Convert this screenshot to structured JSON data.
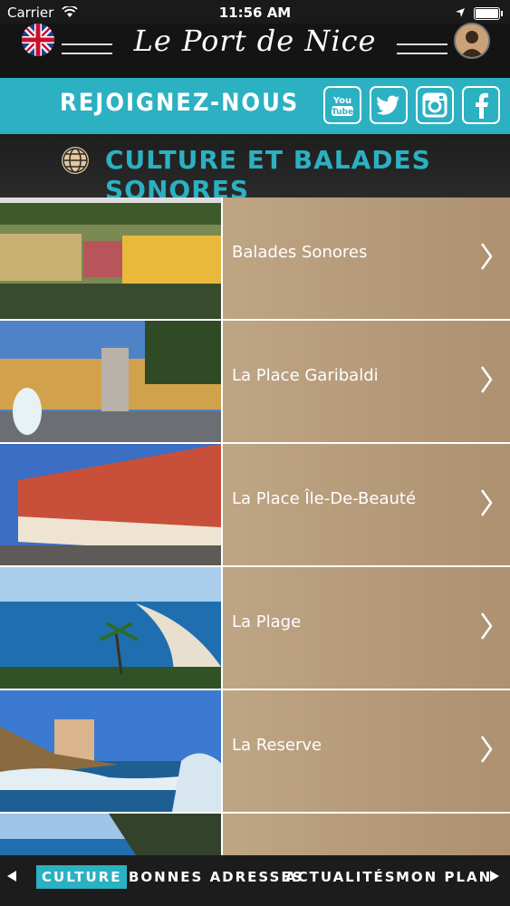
{
  "status_bar": {
    "carrier": "Carrier",
    "time": "11:56 AM"
  },
  "header": {
    "title": "Le Port de Nice",
    "language_icon": "uk-flag-icon",
    "profile_icon": "user-avatar-icon"
  },
  "join": {
    "label": "REJOIGNEZ-NOUS",
    "socials": [
      "YouTube",
      "Twitter",
      "Instagram",
      "Facebook"
    ]
  },
  "section": {
    "title": "CULTURE ET BALADES SONORES",
    "icon": "globe-icon"
  },
  "items": [
    {
      "label": "Balades Sonores"
    },
    {
      "label": "La Place Garibaldi"
    },
    {
      "label": "La Place Île-De-Beauté"
    },
    {
      "label": "La Plage"
    },
    {
      "label": "La Reserve"
    },
    {
      "label": ""
    }
  ],
  "tabs": [
    {
      "label": "CULTURE",
      "active": true
    },
    {
      "label": "BONNES ADRESSES"
    },
    {
      "label": "ACTUALITÉS"
    },
    {
      "label": "MON PLAN"
    }
  ],
  "colors": {
    "accent": "#2bb1c1",
    "panel": "#b59a79",
    "header_bg": "#141414"
  }
}
